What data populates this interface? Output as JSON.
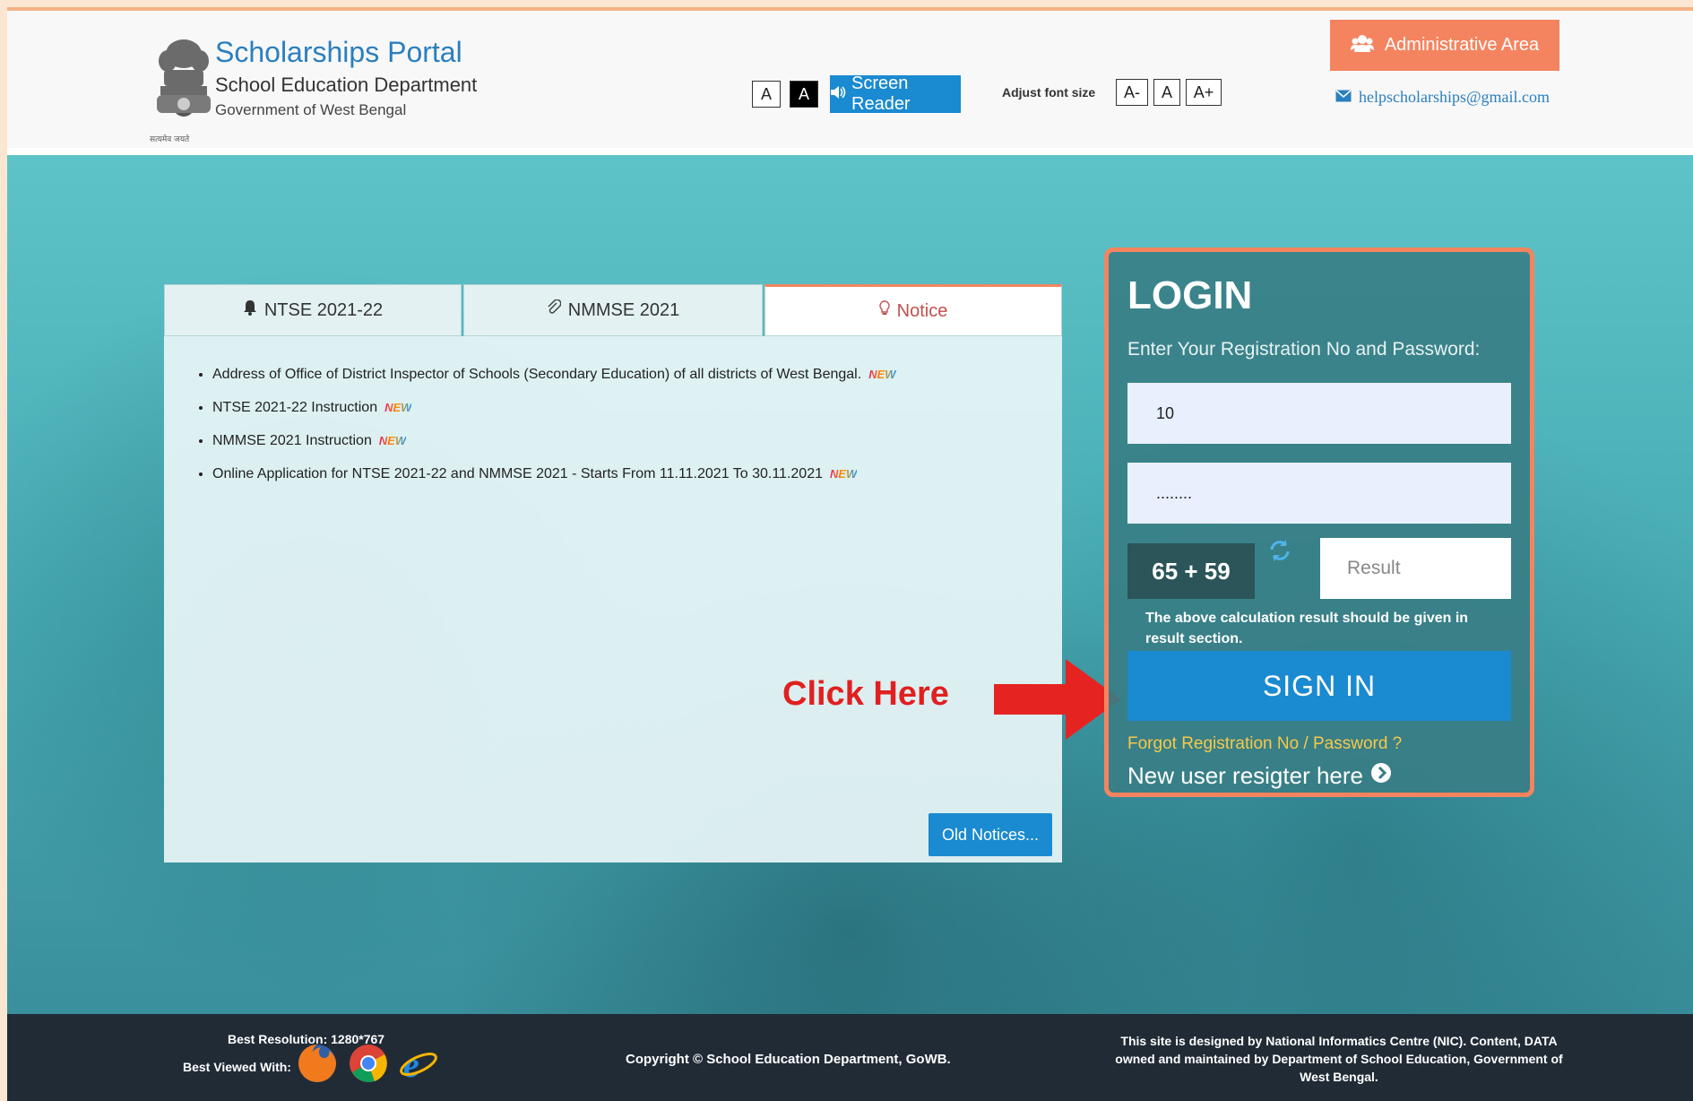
{
  "header": {
    "title": "Scholarships Portal",
    "subtitle": "School Education Department",
    "govt": "Government of West Bengal",
    "emblem_motto": "सत्यमेव जयते",
    "a_normal": "A",
    "a_dark": "A",
    "screen_reader": "Screen Reader",
    "adjust_label": "Adjust font size",
    "font_minus": "A-",
    "font_normal": "A",
    "font_plus": "A+",
    "admin_area": "Administrative Area",
    "email": "helpscholarships@gmail.com"
  },
  "tabs": [
    {
      "label": "NTSE 2021-22",
      "icon": "bell-icon"
    },
    {
      "label": "NMMSE 2021",
      "icon": "paperclip-icon"
    },
    {
      "label": "Notice",
      "icon": "lightbulb-icon",
      "active": true
    }
  ],
  "notices": [
    {
      "text": "Address of Office of District Inspector of Schools (Secondary Education) of all districts of West Bengal.",
      "badge": "NEW"
    },
    {
      "text": "NTSE 2021-22 Instruction",
      "badge": "NEW"
    },
    {
      "text": "NMMSE 2021 Instruction",
      "badge": "NEW"
    },
    {
      "text": "Online Application for NTSE 2021-22 and NMMSE 2021 - Starts From 11.11.2021 To 30.11.2021",
      "badge": "NEW"
    }
  ],
  "old_notices": "Old Notices...",
  "annotation": "Click Here",
  "login": {
    "title": "LOGIN",
    "subtitle": "Enter Your Registration No and Password:",
    "registration_value": "10",
    "password_value": "........",
    "captcha": "65 + 59",
    "result_placeholder": "Result",
    "captcha_note": "The above calculation result should be given in result section.",
    "sign_in": "SIGN IN",
    "forgot": "Forgot Registration No / Password ?",
    "new_user": "New user resigter here"
  },
  "footer": {
    "best_resolution": "Best Resolution: 1280*767",
    "best_viewed": "Best Viewed With:",
    "copyright": "Copyright © School Education Department, GoWB.",
    "nic": "This site is designed by National Informatics Centre (NIC). Content, DATA owned and maintained by Department of School Education, Government of West Bengal."
  },
  "colors": {
    "accent_orange": "#f4845f",
    "primary_blue": "#1a8ad1",
    "teal": "#46a9b3",
    "footer_bg": "#202b36"
  }
}
